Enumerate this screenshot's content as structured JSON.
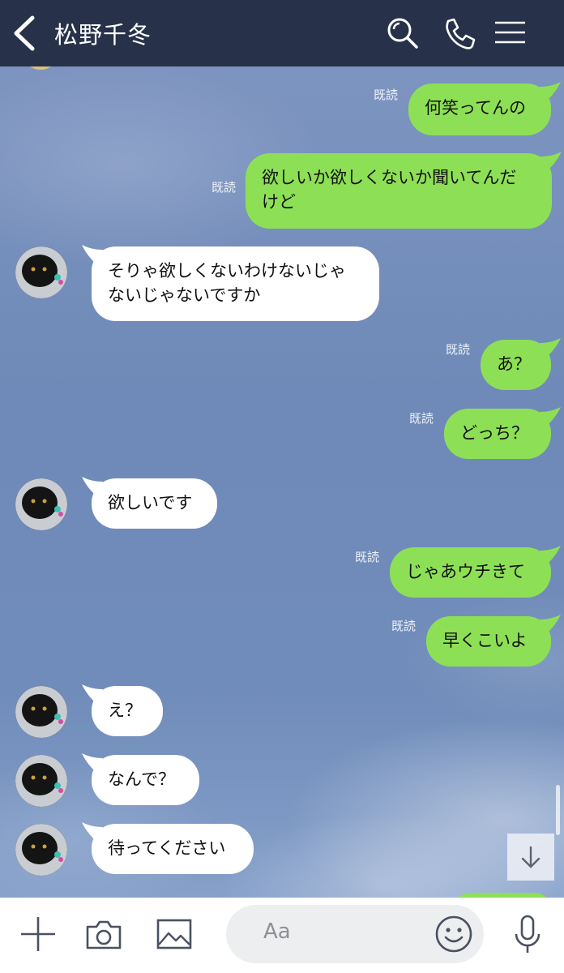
{
  "header": {
    "title": "松野千冬",
    "background": "#27324a"
  },
  "colors": {
    "outgoing_bubble": "#8de055",
    "incoming_bubble": "#ffffff",
    "chat_background": "#7a92bd"
  },
  "messages": [
    {
      "side": "out",
      "text": "何笑ってんの",
      "read": "既読"
    },
    {
      "side": "out",
      "text_line1": "欲しいか欲しくないか聞いてんだ",
      "text_line2": "けど",
      "read": "既読"
    },
    {
      "side": "in",
      "text_line1": "そりゃ欲しくないわけないじゃ",
      "text_line2": "ないじゃないですか"
    },
    {
      "side": "out",
      "text": "あ？",
      "read": "既読"
    },
    {
      "side": "out",
      "text": "どっち？",
      "read": "既読"
    },
    {
      "side": "in",
      "text": "欲しいです"
    },
    {
      "side": "out",
      "text": "じゃあウチきて",
      "read": "既読"
    },
    {
      "side": "out",
      "text": "早くこいよ",
      "read": "既読"
    },
    {
      "side": "in",
      "text": "え？"
    },
    {
      "side": "in",
      "text": "なんで？"
    },
    {
      "side": "in",
      "text": "待ってください"
    }
  ],
  "input": {
    "placeholder": "Aa"
  },
  "icons": {
    "back": "chevron-left-icon",
    "search": "search-icon",
    "call": "phone-icon",
    "menu": "hamburger-menu-icon",
    "add": "plus-icon",
    "camera": "camera-icon",
    "image": "image-icon",
    "emoji": "smiley-icon",
    "mic": "microphone-icon",
    "scroll_down": "arrow-down-icon"
  }
}
